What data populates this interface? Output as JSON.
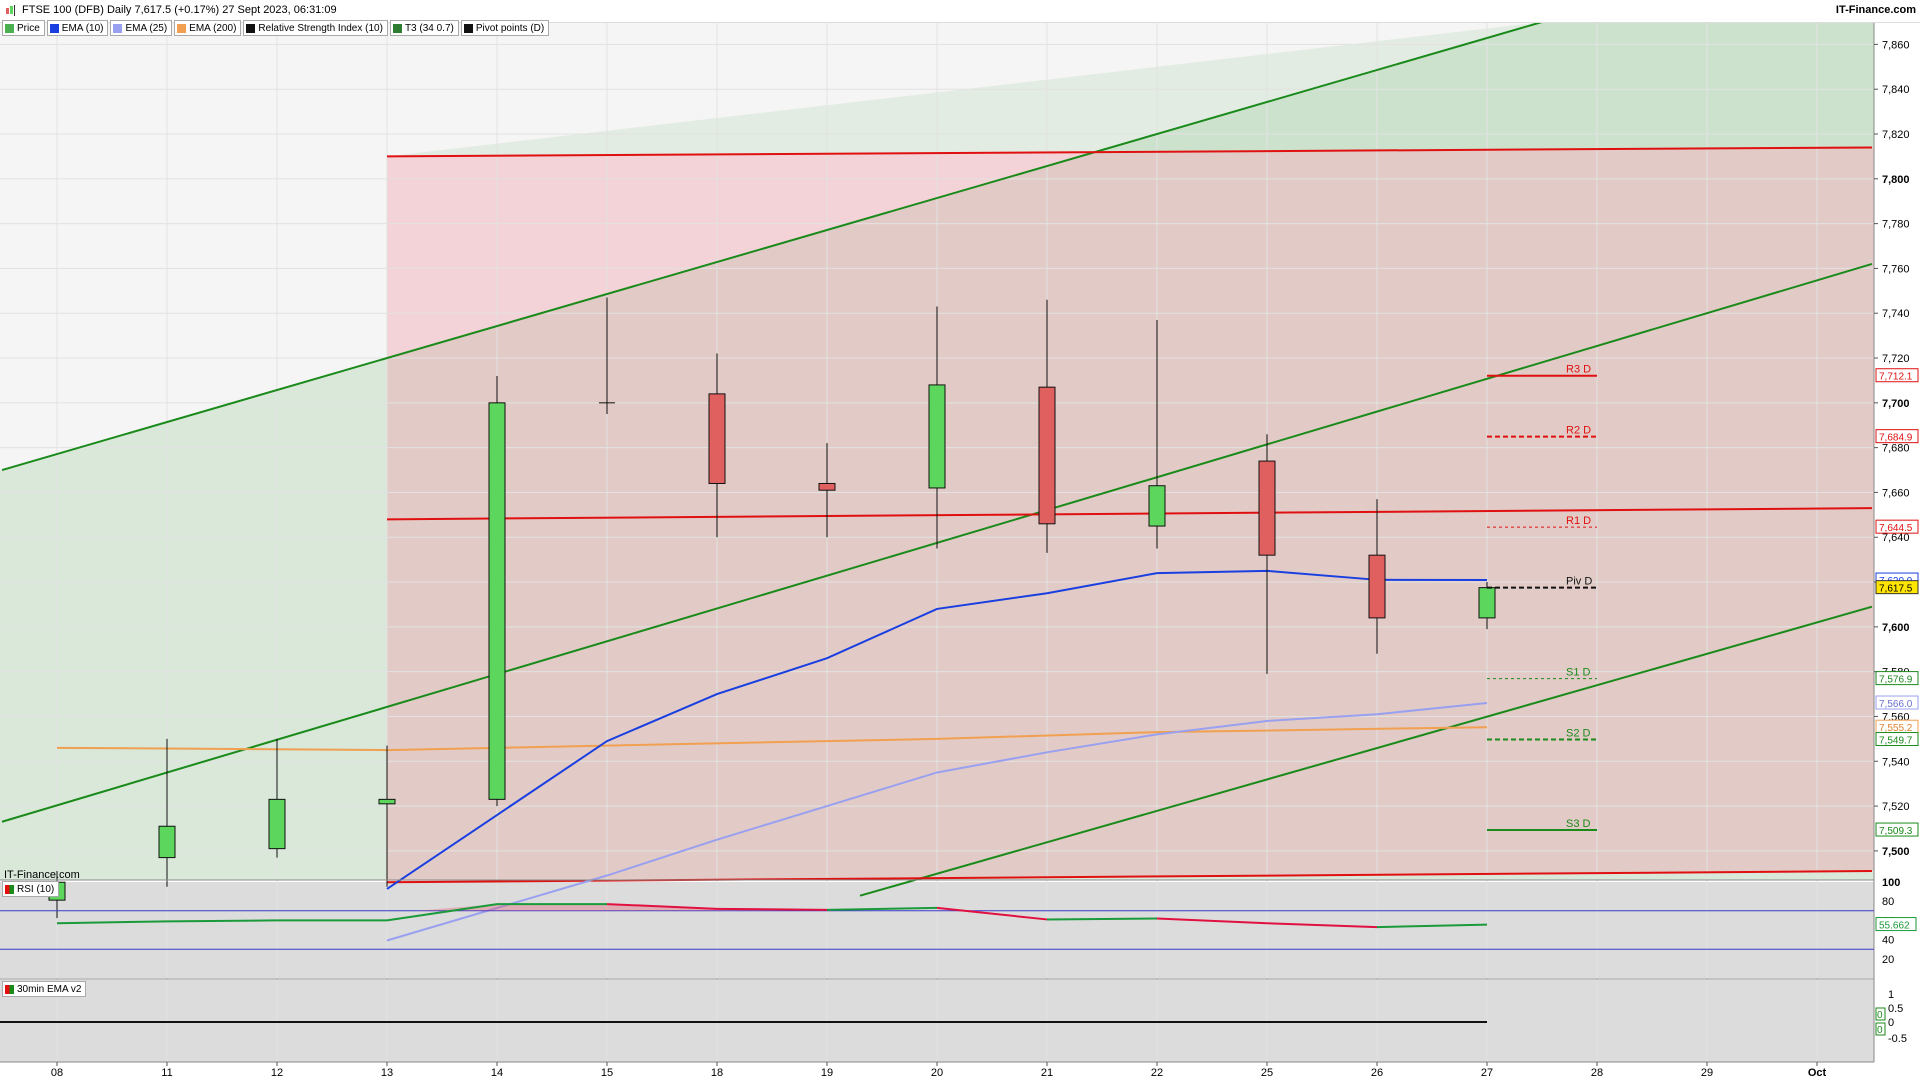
{
  "header": {
    "title": "FTSE 100 (DFB) Daily 7,617.5 (+0.17%) 27 Sept 2023, 06:31:09",
    "brand": "IT-Finance.com"
  },
  "legend": [
    {
      "label": "Price",
      "color": "#4caf50"
    },
    {
      "label": "EMA (10)",
      "color": "#1a3fe0"
    },
    {
      "label": "EMA (25)",
      "color": "#9aa0f0"
    },
    {
      "label": "EMA (200)",
      "color": "#f0a050"
    },
    {
      "label": "Relative Strength Index (10)",
      "color": "#111111"
    },
    {
      "label": "T3 (34 0.7)",
      "color": "#2e7d32"
    },
    {
      "label": "Pivot points (D)",
      "color": "#111111"
    }
  ],
  "watermark": "IT-Finance.com",
  "rsi_label": "RSI (10)",
  "ema30_label": "30min EMA v2",
  "colors": {
    "up": "#5cd65c",
    "down": "#e06060",
    "ema10": "#1a3fe0",
    "ema25": "#9aa0f0",
    "ema200": "#f0a050",
    "channel": "#1a8a1a",
    "redline": "#e01010"
  },
  "chart_data": {
    "type": "candlestick",
    "title": "FTSE 100 (DFB) Daily 7,617.5 (+0.17%) 27 Sept 2023, 06:31:09",
    "x_ticks": [
      "08",
      "11",
      "12",
      "13",
      "14",
      "15",
      "18",
      "19",
      "20",
      "21",
      "22",
      "25",
      "26",
      "27",
      "28",
      "29",
      "Oct"
    ],
    "y_ticks": [
      7500,
      7520,
      7540,
      7560,
      7580,
      7600,
      7620,
      7640,
      7660,
      7680,
      7700,
      7720,
      7740,
      7760,
      7780,
      7800,
      7820,
      7840,
      7860
    ],
    "ylim": [
      7487,
      7870
    ],
    "candles": [
      {
        "date": "08",
        "open": 7478,
        "high": 7491,
        "low": 7470,
        "close": 7486
      },
      {
        "date": "11",
        "open": 7497,
        "high": 7550,
        "low": 7484,
        "close": 7511
      },
      {
        "date": "12",
        "open": 7501,
        "high": 7550,
        "low": 7497,
        "close": 7523
      },
      {
        "date": "13",
        "open": 7521,
        "high": 7547,
        "low": 7484,
        "close": 7523
      },
      {
        "date": "14",
        "open": 7523,
        "high": 7712,
        "low": 7520,
        "close": 7700
      },
      {
        "date": "15",
        "open": 7700,
        "high": 7747,
        "low": 7695,
        "close": 7700
      },
      {
        "date": "18",
        "open": 7704,
        "high": 7722,
        "low": 7640,
        "close": 7664
      },
      {
        "date": "19",
        "open": 7664,
        "high": 7682,
        "low": 7640,
        "close": 7661
      },
      {
        "date": "20",
        "open": 7662,
        "high": 7743,
        "low": 7635,
        "close": 7708
      },
      {
        "date": "21",
        "open": 7707,
        "high": 7746,
        "low": 7633,
        "close": 7646
      },
      {
        "date": "22",
        "open": 7645,
        "high": 7737,
        "low": 7635,
        "close": 7663
      },
      {
        "date": "25",
        "open": 7674,
        "high": 7686,
        "low": 7579,
        "close": 7632
      },
      {
        "date": "26",
        "open": 7632,
        "high": 7657,
        "low": 7588,
        "close": 7604
      },
      {
        "date": "27",
        "open": 7604,
        "high": 7620,
        "low": 7599,
        "close": 7617.5
      }
    ],
    "ema10": [
      {
        "x": "13",
        "y": 7483
      },
      {
        "x": "14",
        "y": 7516
      },
      {
        "x": "15",
        "y": 7549
      },
      {
        "x": "18",
        "y": 7570
      },
      {
        "x": "19",
        "y": 7586
      },
      {
        "x": "20",
        "y": 7608
      },
      {
        "x": "21",
        "y": 7615
      },
      {
        "x": "22",
        "y": 7624
      },
      {
        "x": "25",
        "y": 7625
      },
      {
        "x": "26",
        "y": 7621
      },
      {
        "x": "27",
        "y": 7620.9
      }
    ],
    "ema25": [
      {
        "x": "13",
        "y": 7460
      },
      {
        "x": "15",
        "y": 7489
      },
      {
        "x": "18",
        "y": 7505
      },
      {
        "x": "19",
        "y": 7520
      },
      {
        "x": "20",
        "y": 7535
      },
      {
        "x": "21",
        "y": 7544
      },
      {
        "x": "22",
        "y": 7552
      },
      {
        "x": "25",
        "y": 7558
      },
      {
        "x": "26",
        "y": 7561
      },
      {
        "x": "27",
        "y": 7566.0
      }
    ],
    "ema200": [
      {
        "x": "08",
        "y": 7546
      },
      {
        "x": "13",
        "y": 7545
      },
      {
        "x": "20",
        "y": 7550
      },
      {
        "x": "22",
        "y": 7553
      },
      {
        "x": "27",
        "y": 7555.2
      }
    ],
    "pivots": [
      {
        "label": "R3 D",
        "value": 7712.1,
        "color": "#e01010",
        "style": "solid"
      },
      {
        "label": "R2 D",
        "value": 7684.9,
        "color": "#e01010",
        "style": "dashed"
      },
      {
        "label": "R1 D",
        "value": 7644.5,
        "color": "#e01010",
        "style": "dotted"
      },
      {
        "label": "Piv D",
        "value": 7617.5,
        "color": "#111111",
        "style": "dashed"
      },
      {
        "label": "S1 D",
        "value": 7576.9,
        "color": "#1a8a1a",
        "style": "dotted"
      },
      {
        "label": "S2 D",
        "value": 7549.7,
        "color": "#1a8a1a",
        "style": "dashed"
      },
      {
        "label": "S3 D",
        "value": 7509.3,
        "color": "#1a8a1a",
        "style": "solid"
      }
    ],
    "price_tags": [
      {
        "value": 7712.1,
        "text": "7,712.1",
        "bg": "#ffffff",
        "border": "#e01010",
        "fg": "#e01010"
      },
      {
        "value": 7684.9,
        "text": "7,684.9",
        "bg": "#ffffff",
        "border": "#e01010",
        "fg": "#e01010"
      },
      {
        "value": 7644.5,
        "text": "7,644.5",
        "bg": "#ffffff",
        "border": "#e01010",
        "fg": "#e01010"
      },
      {
        "value": 7620.9,
        "text": "7,620.9",
        "bg": "#ffffff",
        "border": "#1a3fe0",
        "fg": "#1a3fe0"
      },
      {
        "value": 7617.5,
        "text": "7,617.5",
        "bg": "#ffe600",
        "border": "#333333",
        "fg": "#000000"
      },
      {
        "value": 7576.9,
        "text": "7,576.9",
        "bg": "#ffffff",
        "border": "#1a8a1a",
        "fg": "#1a8a1a"
      },
      {
        "value": 7566.0,
        "text": "7,566.0",
        "bg": "#ffffff",
        "border": "#9aa0f0",
        "fg": "#6a70d0"
      },
      {
        "value": 7555.2,
        "text": "7,555.2",
        "bg": "#ffffff",
        "border": "#f0a050",
        "fg": "#e08030"
      },
      {
        "value": 7549.7,
        "text": "7,549.7",
        "bg": "#ffffff",
        "border": "#1a8a1a",
        "fg": "#1a8a1a"
      },
      {
        "value": 7509.3,
        "text": "7,509.3",
        "bg": "#ffffff",
        "border": "#1a8a1a",
        "fg": "#1a8a1a"
      }
    ],
    "channel_lines": [
      {
        "x1": -0.5,
        "y1": 7670,
        "x2": 13.5,
        "y2": 7870
      },
      {
        "x1": -0.5,
        "y1": 7513,
        "x2": 16.5,
        "y2": 7762
      },
      {
        "x1": 7.3,
        "y1": 7480,
        "x2": 16.5,
        "y2": 7609
      }
    ],
    "red_lines": [
      {
        "x1": 3,
        "y1": 7810,
        "x2": 16.5,
        "y2": 7814
      },
      {
        "x1": 3,
        "y1": 7648,
        "x2": 16.5,
        "y2": 7653
      },
      {
        "x1": 3,
        "y1": 7486,
        "x2": 16.5,
        "y2": 7491
      }
    ],
    "rsi": {
      "label": "RSI (10)",
      "y_ticks": [
        100,
        80,
        60,
        40,
        20
      ],
      "ylim": [
        0,
        100
      ],
      "levels": [
        70,
        30
      ],
      "current": 55.662,
      "current_text": "55.662",
      "values": [
        {
          "x": "08",
          "y": 57
        },
        {
          "x": "11",
          "y": 59
        },
        {
          "x": "12",
          "y": 60
        },
        {
          "x": "13",
          "y": 60
        },
        {
          "x": "14",
          "y": 77
        },
        {
          "x": "15",
          "y": 77
        },
        {
          "x": "18",
          "y": 72
        },
        {
          "x": "19",
          "y": 71
        },
        {
          "x": "20",
          "y": 73
        },
        {
          "x": "21",
          "y": 61
        },
        {
          "x": "22",
          "y": 62
        },
        {
          "x": "25",
          "y": 57
        },
        {
          "x": "26",
          "y": 53
        },
        {
          "x": "27",
          "y": 55.662
        }
      ]
    },
    "ema30": {
      "label": "30min EMA v2",
      "y_ticks": [
        "1",
        "0.5",
        "0",
        "-0.5"
      ],
      "value": 0,
      "tags": [
        "0",
        "0"
      ]
    }
  }
}
